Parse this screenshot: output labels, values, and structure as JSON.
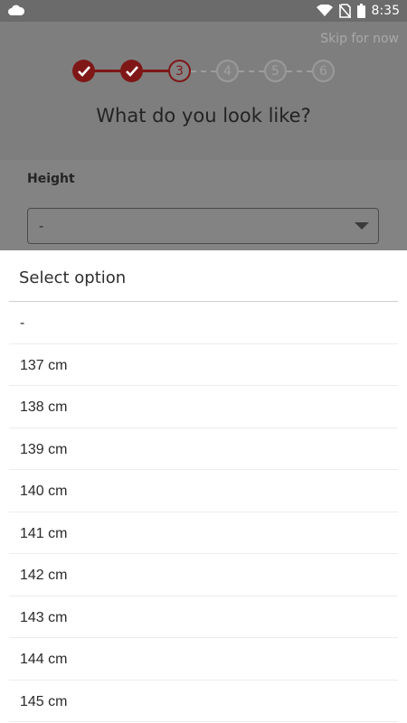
{
  "status_bar": {
    "time": "8:35",
    "icons": [
      "cloud-icon",
      "wifi-icon",
      "no-sim-icon",
      "battery-icon"
    ]
  },
  "header": {
    "skip_label": "Skip for now",
    "steps": [
      {
        "label": "",
        "state": "done"
      },
      {
        "label": "",
        "state": "done"
      },
      {
        "label": "3",
        "state": "current"
      },
      {
        "label": "4",
        "state": "future"
      },
      {
        "label": "5",
        "state": "future"
      },
      {
        "label": "6",
        "state": "future"
      }
    ],
    "title": "What do you look like?"
  },
  "form": {
    "height_label": "Height",
    "height_value": "-"
  },
  "sheet": {
    "title": "Select option",
    "options": [
      "-",
      "137 cm",
      "138 cm",
      "139 cm",
      "140 cm",
      "141 cm",
      "142 cm",
      "143 cm",
      "144 cm",
      "145 cm"
    ]
  },
  "colors": {
    "accent": "#7f1717",
    "overlay_bg": "#838383",
    "sheet_bg": "#ffffff"
  }
}
